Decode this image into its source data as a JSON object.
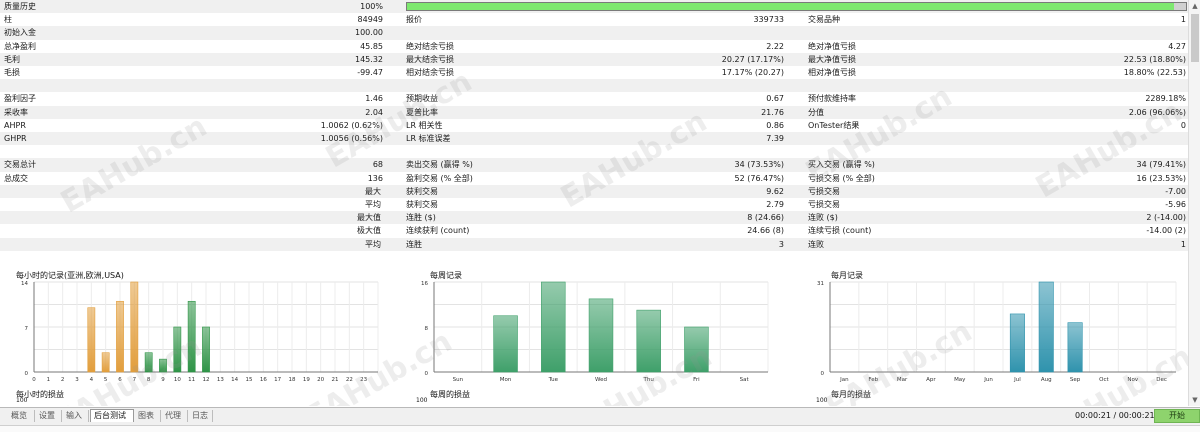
{
  "quality": {
    "label": "质量历史",
    "value": "100%",
    "fill_fraction": 0.985
  },
  "stats_rows": [
    [
      [
        "柱",
        "84949"
      ],
      [
        "报价",
        "339733"
      ],
      [
        "交易品种",
        "1"
      ]
    ],
    [
      [
        "初始入金",
        "100.00"
      ],
      [
        "",
        ""
      ],
      [
        "",
        ""
      ]
    ],
    [
      [
        "总净盈利",
        "45.85"
      ],
      [
        "绝对结余亏损",
        "2.22"
      ],
      [
        "绝对净值亏损",
        "4.27"
      ]
    ],
    [
      [
        "毛利",
        "145.32"
      ],
      [
        "最大结余亏损",
        "20.27 (17.17%)"
      ],
      [
        "最大净值亏损",
        "22.53 (18.80%)"
      ]
    ],
    [
      [
        "毛损",
        "-99.47"
      ],
      [
        "相对结余亏损",
        "17.17% (20.27)"
      ],
      [
        "相对净值亏损",
        "18.80% (22.53)"
      ]
    ],
    [
      [
        "",
        ""
      ],
      [
        "",
        ""
      ],
      [
        "",
        ""
      ]
    ],
    [
      [
        "盈利因子",
        "1.46"
      ],
      [
        "预期收益",
        "0.67"
      ],
      [
        "预付款维持率",
        "2289.18%"
      ]
    ],
    [
      [
        "采收率",
        "2.04"
      ],
      [
        "夏普比率",
        "21.76"
      ],
      [
        "分值",
        "2.06 (96.06%)"
      ]
    ],
    [
      [
        "AHPR",
        "1.0062 (0.62%)"
      ],
      [
        "LR 相关性",
        "0.86"
      ],
      [
        "OnTester结果",
        "0"
      ]
    ],
    [
      [
        "GHPR",
        "1.0056 (0.56%)"
      ],
      [
        "LR 标准误差",
        "7.39"
      ],
      [
        "",
        ""
      ]
    ],
    [
      [
        "",
        ""
      ],
      [
        "",
        ""
      ],
      [
        "",
        ""
      ]
    ],
    [
      [
        "交易总计",
        "68"
      ],
      [
        "卖出交易 (赢得 %)",
        "34 (73.53%)"
      ],
      [
        "买入交易 (赢得 %)",
        "34 (79.41%)"
      ]
    ],
    [
      [
        "总成交",
        "136"
      ],
      [
        "盈利交易 (% 全部)",
        "52 (76.47%)"
      ],
      [
        "亏损交易 (% 全部)",
        "16 (23.53%)"
      ]
    ],
    [
      [
        "最大",
        ""
      ],
      [
        "获利交易",
        "9.62"
      ],
      [
        "亏损交易",
        "-7.00"
      ]
    ],
    [
      [
        "平均",
        ""
      ],
      [
        "获利交易",
        "2.79"
      ],
      [
        "亏损交易",
        "-5.96"
      ]
    ],
    [
      [
        "最大值",
        ""
      ],
      [
        "连胜 ($)",
        "8 (24.66)"
      ],
      [
        "连败 ($)",
        "2 (-14.00)"
      ]
    ],
    [
      [
        "极大值",
        ""
      ],
      [
        "连续获利 (count)",
        "24.66 (8)"
      ],
      [
        "连续亏损 (count)",
        "-14.00 (2)"
      ]
    ],
    [
      [
        "平均",
        ""
      ],
      [
        "连胜",
        "3"
      ],
      [
        "连败",
        "1"
      ]
    ]
  ],
  "watermark": "EAHub.cn",
  "colors": {
    "hour_sell": "#e29e3c",
    "hour_buy": "#2f9447",
    "week_bar": "#3fa06a",
    "month_bar": "#2f93ad",
    "quality_fill": "#7ee86f",
    "start_button": "#8ed36d"
  },
  "chart_data": [
    {
      "type": "bar",
      "title": "每小时的记录(亚洲,欧洲,USA)",
      "subtitle": "每小时的损益",
      "categories": [
        "0",
        "1",
        "2",
        "3",
        "4",
        "5",
        "6",
        "7",
        "8",
        "9",
        "10",
        "11",
        "12",
        "13",
        "14",
        "15",
        "16",
        "17",
        "18",
        "19",
        "20",
        "21",
        "22",
        "23"
      ],
      "series": [
        {
          "values": [
            0,
            0,
            0,
            0,
            10,
            3,
            11,
            14,
            0,
            0,
            0,
            0,
            0,
            0,
            0,
            0,
            0,
            0,
            0,
            0,
            0,
            0,
            0,
            0
          ]
        },
        {
          "values": [
            0,
            0,
            0,
            0,
            0,
            0,
            0,
            0,
            3,
            2,
            7,
            11,
            7,
            0,
            0,
            0,
            0,
            0,
            0,
            0,
            0,
            0,
            0,
            0
          ]
        }
      ],
      "yticks": [
        "14",
        "7",
        "0"
      ],
      "ylim": [
        0,
        14
      ],
      "sub_ytick": "100"
    },
    {
      "type": "bar",
      "title": "每周记录",
      "subtitle": "每周的损益",
      "categories": [
        "Sun",
        "Mon",
        "Tue",
        "Wed",
        "Thu",
        "Fri",
        "Sat"
      ],
      "values": [
        0,
        10,
        16,
        13,
        11,
        8,
        0
      ],
      "yticks": [
        "16",
        "8",
        "0"
      ],
      "ylim": [
        0,
        16
      ],
      "sub_ytick": "100"
    },
    {
      "type": "bar",
      "title": "每月记录",
      "subtitle": "每月的损益",
      "categories": [
        "Jan",
        "Feb",
        "Mar",
        "Apr",
        "May",
        "Jun",
        "Jul",
        "Aug",
        "Sep",
        "Oct",
        "Nov",
        "Dec"
      ],
      "values": [
        0,
        0,
        0,
        0,
        0,
        0,
        20,
        31,
        17,
        0,
        0,
        0
      ],
      "yticks": [
        "31",
        "0"
      ],
      "ylim": [
        0,
        31
      ],
      "sub_ytick": "100"
    }
  ],
  "tabs": [
    "概览",
    "设置",
    "输入",
    "后台测试",
    "图表",
    "代理",
    "日志"
  ],
  "active_tab": "后台测试",
  "timer": "00:00:21 / 00:00:21",
  "start_label": "开始"
}
